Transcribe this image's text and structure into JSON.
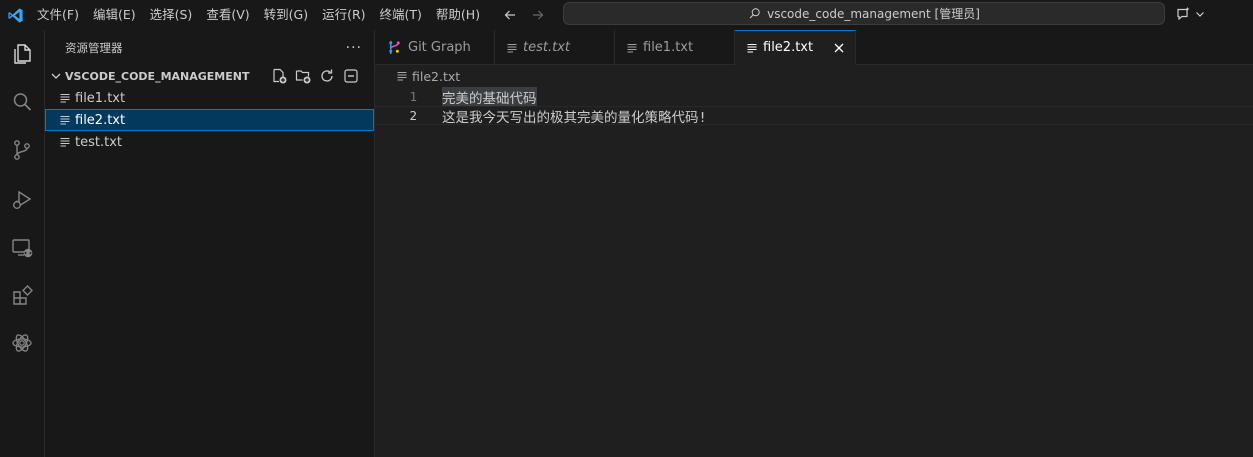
{
  "titlebar": {
    "menu": [
      "文件(F)",
      "编辑(E)",
      "选择(S)",
      "查看(V)",
      "转到(G)",
      "运行(R)",
      "终端(T)",
      "帮助(H)"
    ],
    "command_center": "vscode_code_management [管理员]"
  },
  "activitybar": {
    "icons": [
      "explorer-icon",
      "search-icon",
      "source-control-icon",
      "run-debug-icon",
      "remote-explorer-icon",
      "extensions-icon",
      "chatgpt-icon"
    ]
  },
  "sidebar": {
    "title": "资源管理器",
    "more": "···",
    "folder": "VSCODE_CODE_MANAGEMENT",
    "files": [
      "file1.txt",
      "file2.txt",
      "test.txt"
    ]
  },
  "editor": {
    "tabs": [
      {
        "label": "Git Graph"
      },
      {
        "label": "test.txt"
      },
      {
        "label": "file1.txt"
      },
      {
        "label": "file2.txt"
      }
    ],
    "breadcrumb": "file2.txt",
    "lines": [
      {
        "number": "1",
        "text": "完美的基础代码"
      },
      {
        "number": "2",
        "text": "这是我今天写出的极其完美的量化策略代码!"
      }
    ]
  },
  "colors": {
    "accent": "#0078d4",
    "selection": "#04395e",
    "vscode_logo": "#3aa3f2"
  }
}
